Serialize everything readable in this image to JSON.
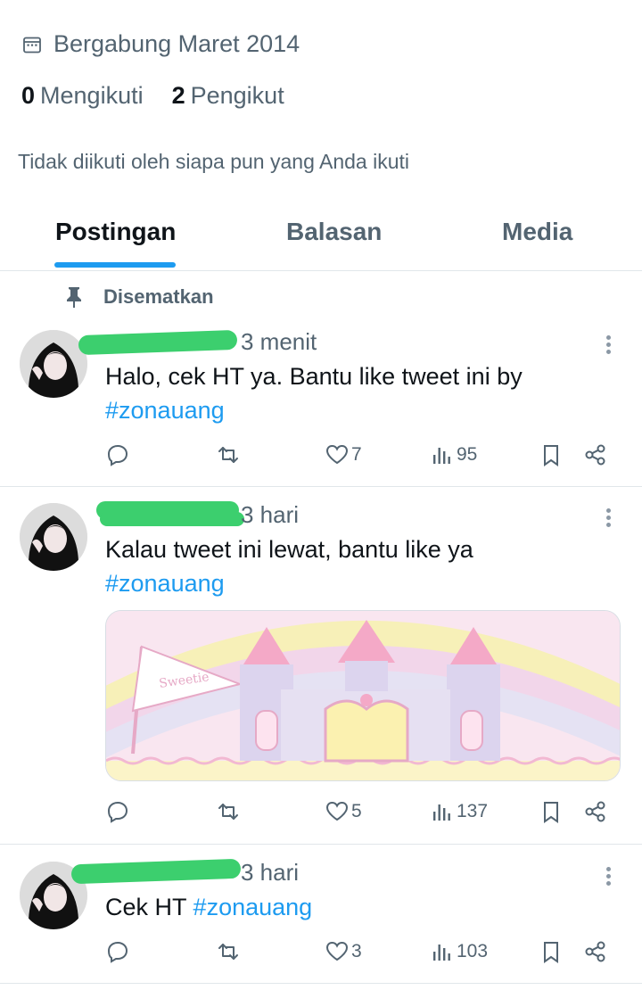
{
  "profile": {
    "joined": "Bergabung Maret 2014",
    "following_count": "0",
    "following_label": "Mengikuti",
    "followers_count": "2",
    "followers_label": "Pengikut",
    "not_followed_text": "Tidak diikuti oleh siapa pun yang Anda ikuti"
  },
  "tabs": [
    {
      "label": "Postingan",
      "active": true
    },
    {
      "label": "Balasan",
      "active": false
    },
    {
      "label": "Media",
      "active": false
    }
  ],
  "pinned_label": "Disematkan",
  "posts": [
    {
      "time": "3 menit",
      "text": "Halo, cek HT ya. Bantu like tweet ini by",
      "hashtag": "#zonauang",
      "likes": "7",
      "views": "95"
    },
    {
      "time": "3 hari",
      "text": "Kalau tweet ini lewat, bantu like ya",
      "hashtag": "#zonauang",
      "likes": "5",
      "views": "137"
    },
    {
      "time": "3 hari",
      "text": "Cek HT",
      "hashtag": "#zonauang",
      "likes": "3",
      "views": "103"
    }
  ],
  "icons": {
    "calendar": "calendar-icon",
    "pin": "pin-icon",
    "reply": "reply-icon",
    "retweet": "retweet-icon",
    "like": "heart-icon",
    "views": "views-icon",
    "bookmark": "bookmark-icon",
    "share": "share-icon",
    "more": "more-icon"
  },
  "colors": {
    "accent": "#1d9bf0",
    "muted": "#536471",
    "redaction": "#3ccf6e"
  }
}
